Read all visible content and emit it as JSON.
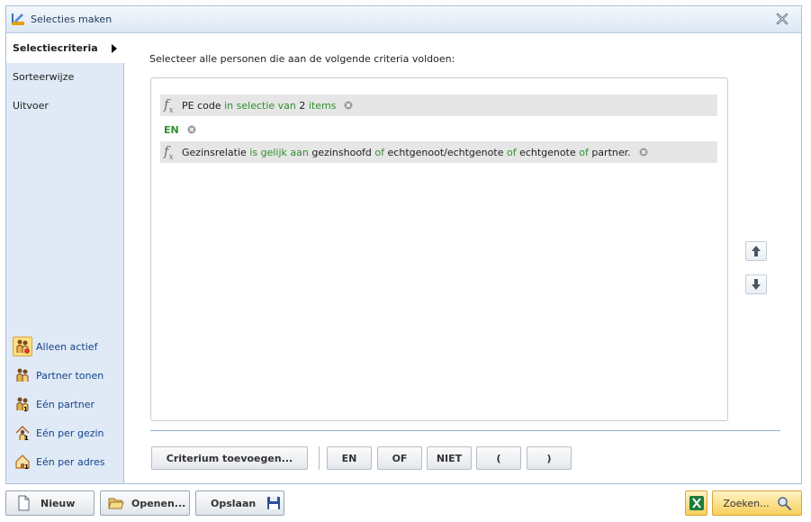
{
  "window": {
    "title": "Selecties maken"
  },
  "nav": {
    "items": [
      {
        "label": "Selectiecriteria",
        "active": true
      },
      {
        "label": "Sorteerwijze",
        "active": false
      },
      {
        "label": "Uitvoer",
        "active": false
      }
    ]
  },
  "filters": [
    {
      "label": "Alleen actief",
      "icon": "people-active-icon",
      "active": true
    },
    {
      "label": "Partner tonen",
      "icon": "partner-icon",
      "active": false
    },
    {
      "label": "Eén partner",
      "icon": "one-partner-icon",
      "active": false
    },
    {
      "label": "Eén per gezin",
      "icon": "one-per-family-icon",
      "active": false
    },
    {
      "label": "Eén per adres",
      "icon": "one-per-address-icon",
      "active": false
    }
  ],
  "main": {
    "heading": "Selecteer alle personen die aan de volgende criteria voldoen:",
    "criteria": [
      {
        "type": "criterion",
        "parts": [
          "PE code",
          "in selectie van",
          "2",
          "items"
        ]
      },
      {
        "type": "operator",
        "label": "EN"
      },
      {
        "type": "criterion",
        "parts": [
          "Gezinsrelatie",
          "is gelijk aan",
          "gezinshoofd",
          "of",
          "echtgenoot/echtgenote",
          "of",
          "echtgenote",
          "of",
          "partner."
        ]
      }
    ]
  },
  "buttons": {
    "add_criterion": "Criterium toevoegen...",
    "en": "EN",
    "of": "OF",
    "niet": "NIET",
    "open_paren": "(",
    "close_paren": ")"
  },
  "footer": {
    "nieuw": "Nieuw",
    "openen": "Openen...",
    "opslaan": "Opslaan",
    "zoeken": "Zoeken..."
  },
  "colors": {
    "keyword_green": "#2f8f2f",
    "nav_background": "#dfeaf6",
    "highlight_orange": "#f7cf5c"
  }
}
